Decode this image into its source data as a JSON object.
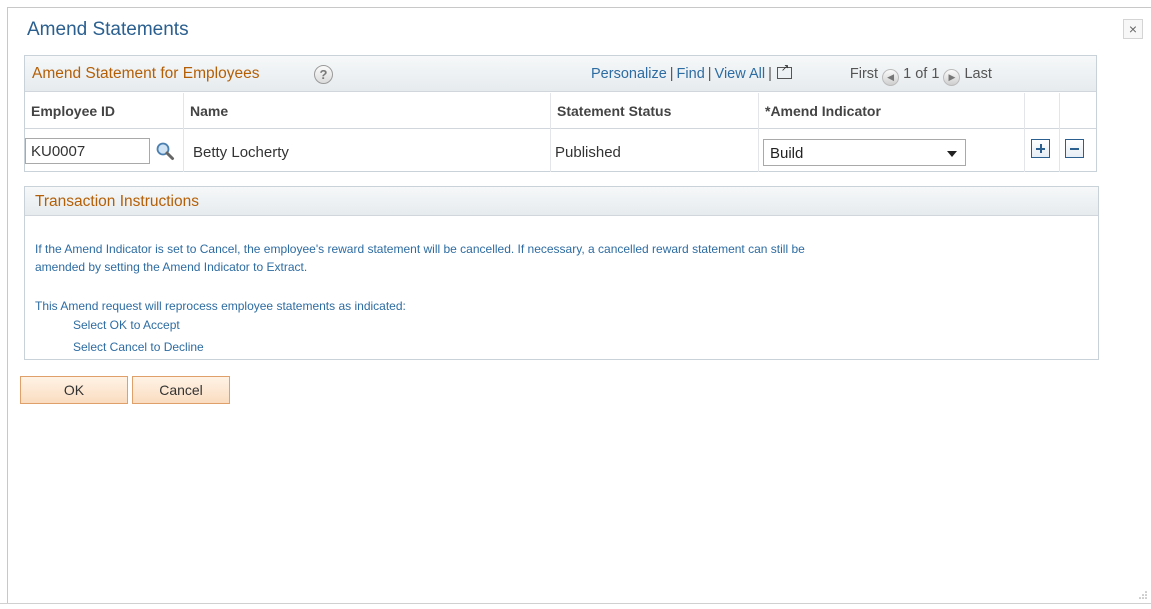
{
  "page": {
    "title": "Amend Statements",
    "close_label": "×"
  },
  "grid": {
    "title": "Amend Statement for Employees",
    "help_label": "?",
    "nav": {
      "personalize": "Personalize",
      "find": "Find",
      "view_all": "View All",
      "first": "First",
      "range": "1 of 1",
      "last": "Last"
    },
    "columns": {
      "employee_id": "Employee ID",
      "name": "Name",
      "status": "Statement Status",
      "amend": "*Amend Indicator"
    },
    "rows": [
      {
        "employee_id": "KU0007",
        "name": "Betty Locherty",
        "status": "Published",
        "amend": "Build"
      }
    ]
  },
  "instructions": {
    "title": "Transaction Instructions",
    "lines": [
      "If the Amend Indicator is set to Cancel, the employee's reward statement will be cancelled.  If necessary, a cancelled reward statement can still be",
      "amended by setting the Amend Indicator to Extract.",
      "This Amend request will reprocess employee statements as indicated:",
      "Select OK to Accept",
      "Select Cancel to Decline"
    ]
  },
  "buttons": {
    "ok": "OK",
    "cancel": "Cancel"
  },
  "colors": {
    "title_blue": "#2a5f8f",
    "section_orange": "#b45f06",
    "link_blue": "#2d6ca2",
    "button_border": "#e0a06a"
  }
}
